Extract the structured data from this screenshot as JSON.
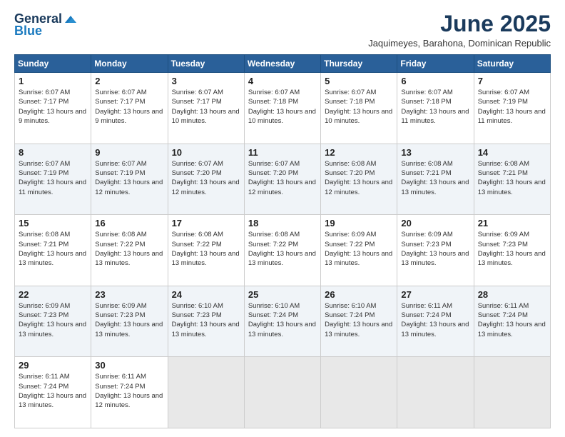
{
  "header": {
    "logo_line1": "General",
    "logo_line2": "Blue",
    "title": "June 2025",
    "subtitle": "Jaquimeyes, Barahona, Dominican Republic"
  },
  "weekdays": [
    "Sunday",
    "Monday",
    "Tuesday",
    "Wednesday",
    "Thursday",
    "Friday",
    "Saturday"
  ],
  "weeks": [
    [
      {
        "day": 1,
        "sunrise": "6:07 AM",
        "sunset": "7:17 PM",
        "daylight": "13 hours and 9 minutes."
      },
      {
        "day": 2,
        "sunrise": "6:07 AM",
        "sunset": "7:17 PM",
        "daylight": "13 hours and 9 minutes."
      },
      {
        "day": 3,
        "sunrise": "6:07 AM",
        "sunset": "7:17 PM",
        "daylight": "13 hours and 10 minutes."
      },
      {
        "day": 4,
        "sunrise": "6:07 AM",
        "sunset": "7:18 PM",
        "daylight": "13 hours and 10 minutes."
      },
      {
        "day": 5,
        "sunrise": "6:07 AM",
        "sunset": "7:18 PM",
        "daylight": "13 hours and 10 minutes."
      },
      {
        "day": 6,
        "sunrise": "6:07 AM",
        "sunset": "7:18 PM",
        "daylight": "13 hours and 11 minutes."
      },
      {
        "day": 7,
        "sunrise": "6:07 AM",
        "sunset": "7:19 PM",
        "daylight": "13 hours and 11 minutes."
      }
    ],
    [
      {
        "day": 8,
        "sunrise": "6:07 AM",
        "sunset": "7:19 PM",
        "daylight": "13 hours and 11 minutes."
      },
      {
        "day": 9,
        "sunrise": "6:07 AM",
        "sunset": "7:19 PM",
        "daylight": "13 hours and 12 minutes."
      },
      {
        "day": 10,
        "sunrise": "6:07 AM",
        "sunset": "7:20 PM",
        "daylight": "13 hours and 12 minutes."
      },
      {
        "day": 11,
        "sunrise": "6:07 AM",
        "sunset": "7:20 PM",
        "daylight": "13 hours and 12 minutes."
      },
      {
        "day": 12,
        "sunrise": "6:08 AM",
        "sunset": "7:20 PM",
        "daylight": "13 hours and 12 minutes."
      },
      {
        "day": 13,
        "sunrise": "6:08 AM",
        "sunset": "7:21 PM",
        "daylight": "13 hours and 13 minutes."
      },
      {
        "day": 14,
        "sunrise": "6:08 AM",
        "sunset": "7:21 PM",
        "daylight": "13 hours and 13 minutes."
      }
    ],
    [
      {
        "day": 15,
        "sunrise": "6:08 AM",
        "sunset": "7:21 PM",
        "daylight": "13 hours and 13 minutes."
      },
      {
        "day": 16,
        "sunrise": "6:08 AM",
        "sunset": "7:22 PM",
        "daylight": "13 hours and 13 minutes."
      },
      {
        "day": 17,
        "sunrise": "6:08 AM",
        "sunset": "7:22 PM",
        "daylight": "13 hours and 13 minutes."
      },
      {
        "day": 18,
        "sunrise": "6:08 AM",
        "sunset": "7:22 PM",
        "daylight": "13 hours and 13 minutes."
      },
      {
        "day": 19,
        "sunrise": "6:09 AM",
        "sunset": "7:22 PM",
        "daylight": "13 hours and 13 minutes."
      },
      {
        "day": 20,
        "sunrise": "6:09 AM",
        "sunset": "7:23 PM",
        "daylight": "13 hours and 13 minutes."
      },
      {
        "day": 21,
        "sunrise": "6:09 AM",
        "sunset": "7:23 PM",
        "daylight": "13 hours and 13 minutes."
      }
    ],
    [
      {
        "day": 22,
        "sunrise": "6:09 AM",
        "sunset": "7:23 PM",
        "daylight": "13 hours and 13 minutes."
      },
      {
        "day": 23,
        "sunrise": "6:09 AM",
        "sunset": "7:23 PM",
        "daylight": "13 hours and 13 minutes."
      },
      {
        "day": 24,
        "sunrise": "6:10 AM",
        "sunset": "7:23 PM",
        "daylight": "13 hours and 13 minutes."
      },
      {
        "day": 25,
        "sunrise": "6:10 AM",
        "sunset": "7:24 PM",
        "daylight": "13 hours and 13 minutes."
      },
      {
        "day": 26,
        "sunrise": "6:10 AM",
        "sunset": "7:24 PM",
        "daylight": "13 hours and 13 minutes."
      },
      {
        "day": 27,
        "sunrise": "6:11 AM",
        "sunset": "7:24 PM",
        "daylight": "13 hours and 13 minutes."
      },
      {
        "day": 28,
        "sunrise": "6:11 AM",
        "sunset": "7:24 PM",
        "daylight": "13 hours and 13 minutes."
      }
    ],
    [
      {
        "day": 29,
        "sunrise": "6:11 AM",
        "sunset": "7:24 PM",
        "daylight": "13 hours and 13 minutes."
      },
      {
        "day": 30,
        "sunrise": "6:11 AM",
        "sunset": "7:24 PM",
        "daylight": "13 hours and 12 minutes."
      },
      null,
      null,
      null,
      null,
      null
    ]
  ]
}
